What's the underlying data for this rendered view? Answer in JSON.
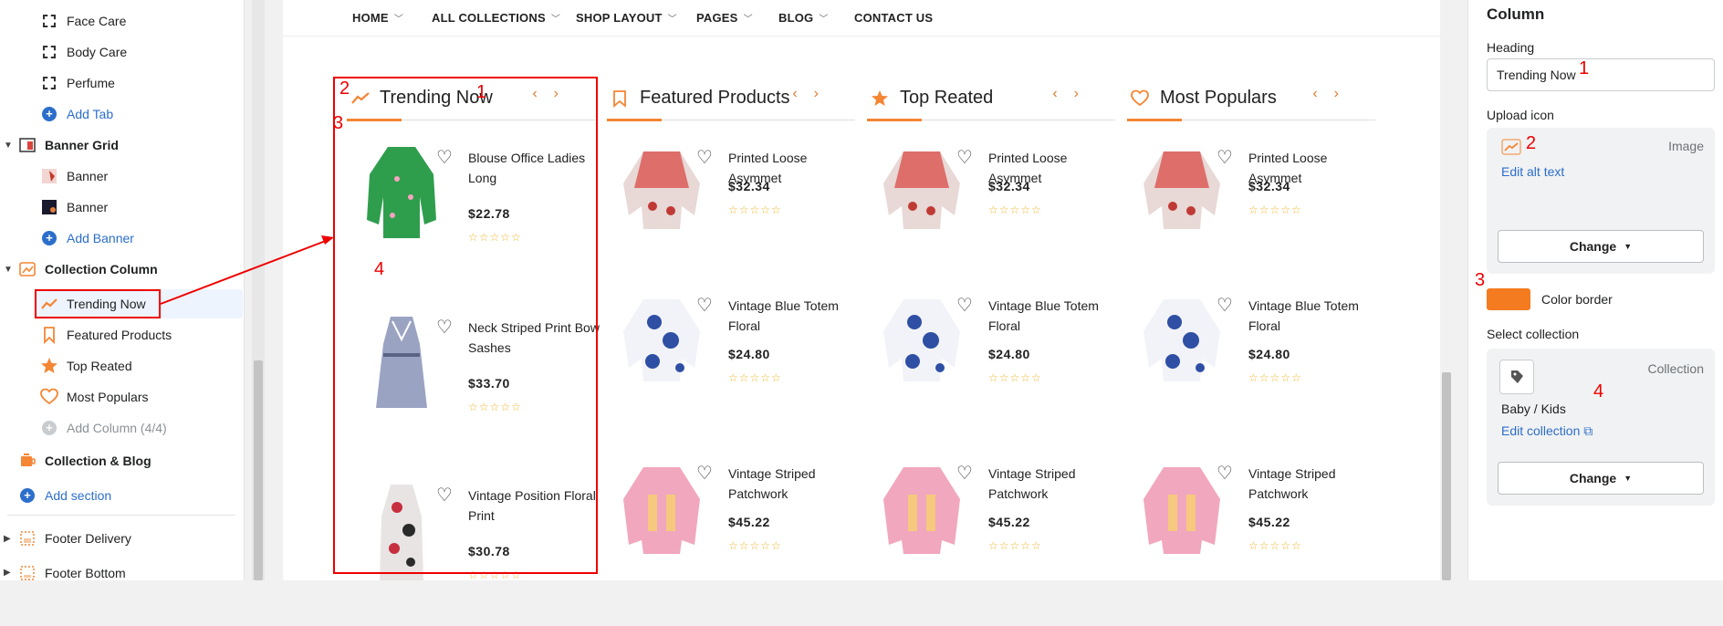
{
  "sidebar": {
    "tab_items": [
      {
        "label": "Face Care"
      },
      {
        "label": "Body Care"
      },
      {
        "label": "Perfume"
      }
    ],
    "add_tab": "Add Tab",
    "banner_grid": "Banner Grid",
    "banners": [
      {
        "label": "Banner"
      },
      {
        "label": "Banner"
      }
    ],
    "add_banner": "Add Banner",
    "collection_column": "Collection Column",
    "columns": [
      {
        "label": "Trending Now"
      },
      {
        "label": "Featured Products"
      },
      {
        "label": "Top Reated"
      },
      {
        "label": "Most Populars"
      }
    ],
    "add_column": "Add Column (4/4)",
    "collection_blog": "Collection & Blog",
    "add_section": "Add section",
    "footer_delivery": "Footer Delivery",
    "footer_bottom": "Footer Bottom"
  },
  "nav": {
    "items": [
      "HOME",
      "ALL COLLECTIONS",
      "SHOP LAYOUT",
      "PAGES",
      "BLOG",
      "CONTACT US"
    ]
  },
  "columns": [
    {
      "title": "Trending Now",
      "icon": "trending-icon",
      "products": [
        {
          "name": "Blouse Office Ladies Long",
          "price": "$22.78",
          "image": "green-blouse"
        },
        {
          "name": "Neck Striped Print Bow Sashes",
          "price": "$33.70",
          "image": "striped-dress"
        },
        {
          "name": "Vintage Position Floral Print",
          "price": "$30.78",
          "image": "floral-dress"
        }
      ]
    },
    {
      "title": "Featured Products",
      "icon": "bookmark-icon",
      "products": [
        {
          "name": "Printed Loose Asymmet",
          "price": "$32.34",
          "image": "red-print-blouse"
        },
        {
          "name": "Vintage Blue Totem Floral",
          "price": "$24.80",
          "image": "blue-totem-blouse"
        },
        {
          "name": "Vintage Striped Patchwork",
          "price": "$45.22",
          "image": "pink-striped-shirt"
        }
      ]
    },
    {
      "title": "Top Reated",
      "icon": "star-icon",
      "products": [
        {
          "name": "Printed Loose Asymmet",
          "price": "$32.34",
          "image": "red-print-blouse"
        },
        {
          "name": "Vintage Blue Totem Floral",
          "price": "$24.80",
          "image": "blue-totem-blouse"
        },
        {
          "name": "Vintage Striped Patchwork",
          "price": "$45.22",
          "image": "pink-striped-shirt"
        }
      ]
    },
    {
      "title": "Most Populars",
      "icon": "heart-icon",
      "products": [
        {
          "name": "Printed Loose Asymmet",
          "price": "$32.34",
          "image": "red-print-blouse"
        },
        {
          "name": "Vintage Blue Totem Floral",
          "price": "$24.80",
          "image": "blue-totem-blouse"
        },
        {
          "name": "Vintage Striped Patchwork",
          "price": "$45.22",
          "image": "pink-striped-shirt"
        }
      ]
    }
  ],
  "settings": {
    "title": "Column",
    "heading_label": "Heading",
    "heading_value": "Trending Now",
    "upload_icon_label": "Upload icon",
    "image_label": "Image",
    "edit_alt_text": "Edit alt text",
    "change_label": "Change",
    "color_border_label": "Color border",
    "color_border_value": "#f47b20",
    "select_collection_label": "Select collection",
    "collection_label": "Collection",
    "collection_value": "Baby / Kids",
    "edit_collection": "Edit collection"
  },
  "annotations": [
    "1",
    "2",
    "3",
    "4"
  ],
  "colors": {
    "accent": "#f48634",
    "link": "#2c6ecb",
    "annotation_red": "#e00000"
  }
}
